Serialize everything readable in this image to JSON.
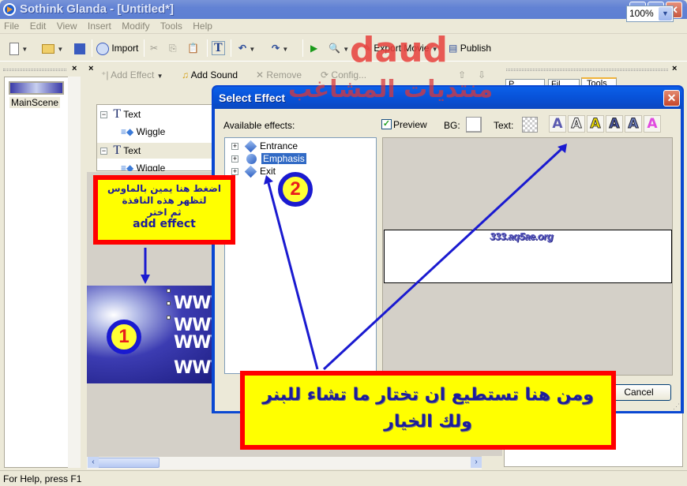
{
  "window": {
    "title": "Sothink Glanda - [Untitled*]",
    "minimize": "_",
    "maximize": "□",
    "close": "✕"
  },
  "menu": [
    "File",
    "Edit",
    "View",
    "Insert",
    "Modify",
    "Tools",
    "Help"
  ],
  "toolbar": {
    "import_label": "Import",
    "export_label": "Export Movie",
    "publish_label": "Publish",
    "zoom_value": "100%"
  },
  "scene_panel": {
    "scene_name": "MainScene"
  },
  "effect_toolbar": {
    "add_effect": "Add Effect",
    "add_sound": "Add Sound",
    "remove": "Remove",
    "config": "Config..."
  },
  "effect_tree": [
    {
      "label": "Text",
      "child": "Wiggle"
    },
    {
      "label": "Text",
      "child": "Wiggle"
    }
  ],
  "right_panel": {
    "tabs": [
      "P...",
      "Fil...",
      "Tools"
    ]
  },
  "dialog": {
    "title": "Select Effect",
    "available_label": "Available effects:",
    "preview_label": "Preview",
    "preview_checked": true,
    "bg_label": "BG:",
    "text_label": "Text:",
    "effects": [
      "Entrance",
      "Emphasis",
      "Exit"
    ],
    "selected_effect": "Emphasis",
    "preview_text": "333.aq5ae.org",
    "cancel_label": "Cancel",
    "text_styles": [
      "A",
      "A",
      "A",
      "A",
      "A",
      "A"
    ]
  },
  "stage": {
    "banner_lines": [
      "WWW",
      "WWW",
      "WWW",
      "WWW"
    ]
  },
  "annotations": {
    "note1_lines": [
      "اضغط هنا يمين بالماوس",
      "لتظهر هذه النافذة",
      "ثم اختر",
      "add effect"
    ],
    "note2_lines": [
      "ومن هنا تستطيع ان تختار ما تشاء للبنر",
      "ولك الخيار"
    ],
    "badge1": "1",
    "badge2": "2",
    "watermark_latin": "daud",
    "watermark_arabic": "منتديات المشاغب"
  },
  "status": {
    "text": "For Help, press F1"
  }
}
